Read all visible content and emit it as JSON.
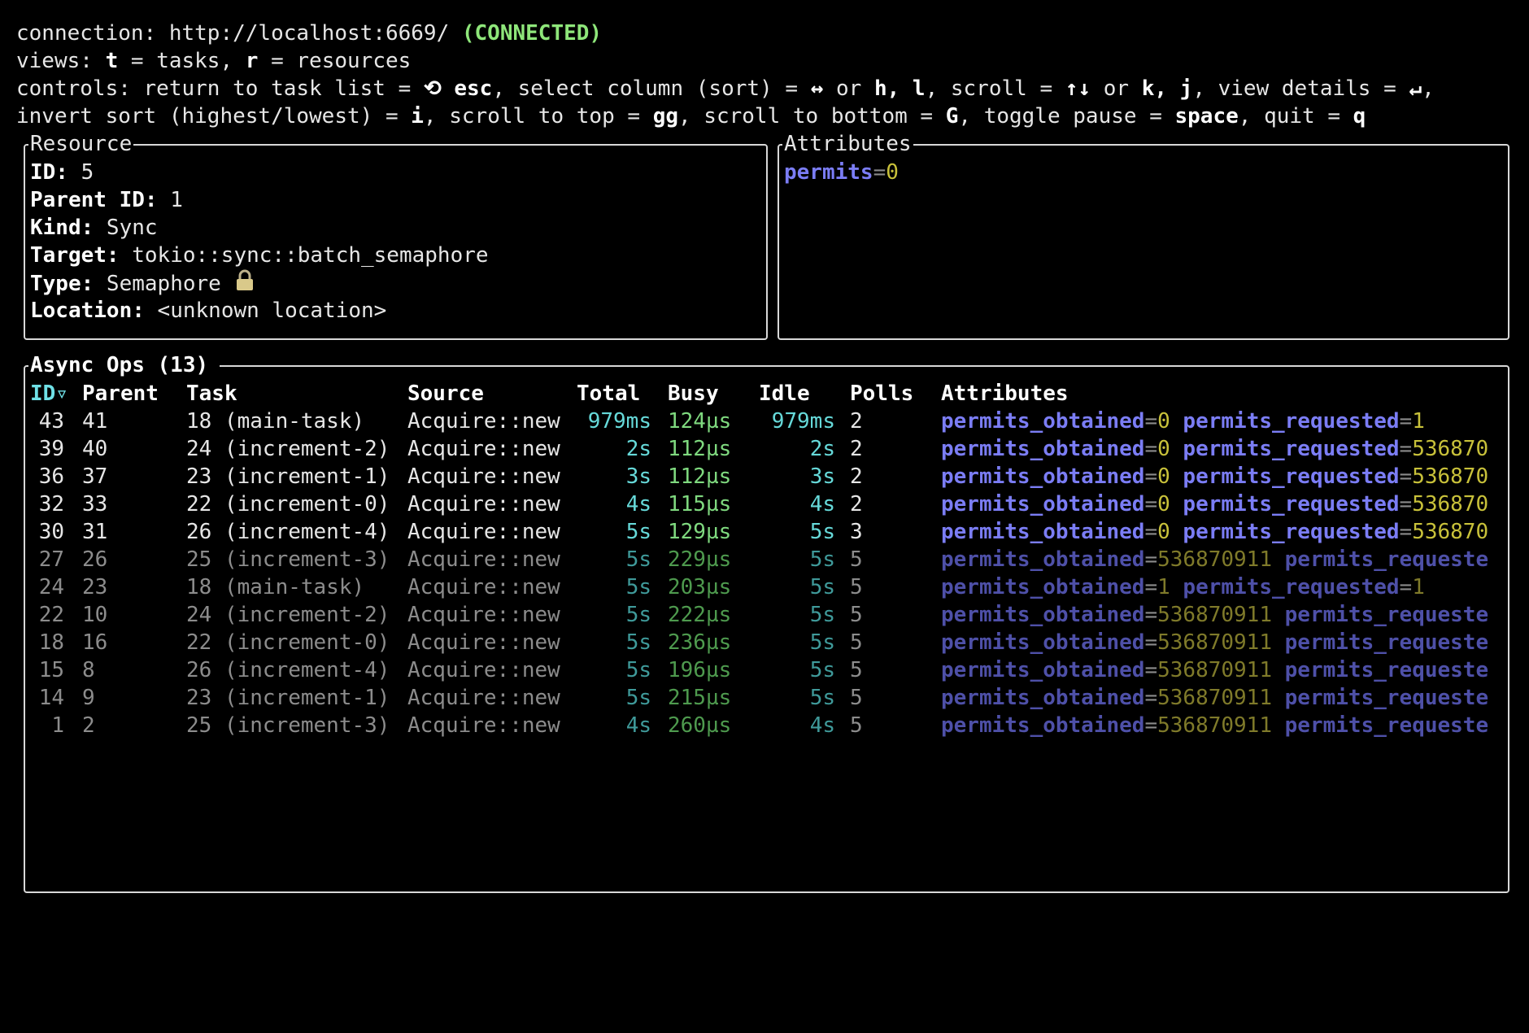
{
  "header": {
    "connection_label": "connection: ",
    "connection_url": "http://localhost:6669/",
    "connection_status": "(CONNECTED)",
    "views_prefix": "views: ",
    "views_t_key": "t",
    "views_t_text": " = tasks, ",
    "views_r_key": "r",
    "views_r_text": " = resources",
    "controls_line1_parts": [
      {
        "t": "controls: return to task list = ",
        "b": false
      },
      {
        "t": "⟲ esc",
        "b": true
      },
      {
        "t": ", select column (sort) = ",
        "b": false
      },
      {
        "t": "↔",
        "b": true
      },
      {
        "t": " or ",
        "b": false
      },
      {
        "t": "h, l",
        "b": true
      },
      {
        "t": ", scroll = ",
        "b": false
      },
      {
        "t": "↑↓",
        "b": true
      },
      {
        "t": " or ",
        "b": false
      },
      {
        "t": "k, j",
        "b": true
      },
      {
        "t": ", view details = ",
        "b": false
      },
      {
        "t": "↵",
        "b": true
      },
      {
        "t": ",",
        "b": false
      }
    ],
    "controls_line2_parts": [
      {
        "t": "invert sort (highest/lowest) = ",
        "b": false
      },
      {
        "t": "i",
        "b": true
      },
      {
        "t": ", scroll to top = ",
        "b": false
      },
      {
        "t": "gg",
        "b": true
      },
      {
        "t": ", scroll to bottom = ",
        "b": false
      },
      {
        "t": "G",
        "b": true
      },
      {
        "t": ", toggle pause = ",
        "b": false
      },
      {
        "t": "space",
        "b": true
      },
      {
        "t": ", quit = ",
        "b": false
      },
      {
        "t": "q",
        "b": true
      }
    ]
  },
  "resource": {
    "title": "Resource",
    "id_label": "ID: ",
    "id": "5",
    "parent_label": "Parent ID: ",
    "parent": "1",
    "kind_label": "Kind: ",
    "kind": "Sync",
    "target_label": "Target: ",
    "target": "tokio::sync::batch_semaphore",
    "type_label": "Type: ",
    "type": "Semaphore",
    "type_icon": "lock-icon",
    "location_label": "Location: ",
    "location": "<unknown location>"
  },
  "attributes": {
    "title": "Attributes",
    "name": "permits",
    "eq": "=",
    "value": "0"
  },
  "async_ops": {
    "title": "Async Ops (13)",
    "columns": [
      "ID",
      "Parent",
      "Task",
      "Source",
      "Total",
      "Busy",
      "Idle",
      "Polls",
      "Attributes"
    ],
    "sort_indicator": "▿",
    "rows": [
      {
        "id": "43",
        "parent": "41",
        "task": "18 (main-task)",
        "source": "Acquire::new",
        "total": "979ms",
        "busy": "124µs",
        "idle": "979ms",
        "polls": "2",
        "a1n": "permits_obtained",
        "a1v": "0",
        "a2n": "permits_requested",
        "a2v": "1",
        "dim": false
      },
      {
        "id": "39",
        "parent": "40",
        "task": "24 (increment-2)",
        "source": "Acquire::new",
        "total": "2s",
        "busy": "112µs",
        "idle": "2s",
        "polls": "2",
        "a1n": "permits_obtained",
        "a1v": "0",
        "a2n": "permits_requested",
        "a2v": "536870",
        "dim": false
      },
      {
        "id": "36",
        "parent": "37",
        "task": "23 (increment-1)",
        "source": "Acquire::new",
        "total": "3s",
        "busy": "112µs",
        "idle": "3s",
        "polls": "2",
        "a1n": "permits_obtained",
        "a1v": "0",
        "a2n": "permits_requested",
        "a2v": "536870",
        "dim": false
      },
      {
        "id": "32",
        "parent": "33",
        "task": "22 (increment-0)",
        "source": "Acquire::new",
        "total": "4s",
        "busy": "115µs",
        "idle": "4s",
        "polls": "2",
        "a1n": "permits_obtained",
        "a1v": "0",
        "a2n": "permits_requested",
        "a2v": "536870",
        "dim": false
      },
      {
        "id": "30",
        "parent": "31",
        "task": "26 (increment-4)",
        "source": "Acquire::new",
        "total": "5s",
        "busy": "129µs",
        "idle": "5s",
        "polls": "3",
        "a1n": "permits_obtained",
        "a1v": "0",
        "a2n": "permits_requested",
        "a2v": "536870",
        "dim": false
      },
      {
        "id": "27",
        "parent": "26",
        "task": "25 (increment-3)",
        "source": "Acquire::new",
        "total": "5s",
        "busy": "229µs",
        "idle": "5s",
        "polls": "5",
        "a1n": "permits_obtained",
        "a1v": "536870911",
        "a2n": "permits_requeste",
        "a2v": "",
        "dim": true
      },
      {
        "id": "24",
        "parent": "23",
        "task": "18 (main-task)",
        "source": "Acquire::new",
        "total": "5s",
        "busy": "203µs",
        "idle": "5s",
        "polls": "5",
        "a1n": "permits_obtained",
        "a1v": "1",
        "a2n": "permits_requested",
        "a2v": "1",
        "dim": true
      },
      {
        "id": "22",
        "parent": "10",
        "task": "24 (increment-2)",
        "source": "Acquire::new",
        "total": "5s",
        "busy": "222µs",
        "idle": "5s",
        "polls": "5",
        "a1n": "permits_obtained",
        "a1v": "536870911",
        "a2n": "permits_requeste",
        "a2v": "",
        "dim": true
      },
      {
        "id": "18",
        "parent": "16",
        "task": "22 (increment-0)",
        "source": "Acquire::new",
        "total": "5s",
        "busy": "236µs",
        "idle": "5s",
        "polls": "5",
        "a1n": "permits_obtained",
        "a1v": "536870911",
        "a2n": "permits_requeste",
        "a2v": "",
        "dim": true
      },
      {
        "id": "15",
        "parent": "8",
        "task": "26 (increment-4)",
        "source": "Acquire::new",
        "total": "5s",
        "busy": "196µs",
        "idle": "5s",
        "polls": "5",
        "a1n": "permits_obtained",
        "a1v": "536870911",
        "a2n": "permits_requeste",
        "a2v": "",
        "dim": true
      },
      {
        "id": "14",
        "parent": "9",
        "task": "23 (increment-1)",
        "source": "Acquire::new",
        "total": "5s",
        "busy": "215µs",
        "idle": "5s",
        "polls": "5",
        "a1n": "permits_obtained",
        "a1v": "536870911",
        "a2n": "permits_requeste",
        "a2v": "",
        "dim": true
      },
      {
        "id": "1",
        "parent": "2",
        "task": "25 (increment-3)",
        "source": "Acquire::new",
        "total": "4s",
        "busy": "260µs",
        "idle": "4s",
        "polls": "5",
        "a1n": "permits_obtained",
        "a1v": "536870911",
        "a2n": "permits_requeste",
        "a2v": "",
        "dim": true
      }
    ]
  },
  "colors": {
    "background": "#000000",
    "connected": "#8ee67a",
    "attr_name": "#7b7df5",
    "attr_value": "#c8c13a",
    "time_cyan": "#66d9d9",
    "time_green": "#7fd97f",
    "selected_header": "#6fe0e6"
  }
}
